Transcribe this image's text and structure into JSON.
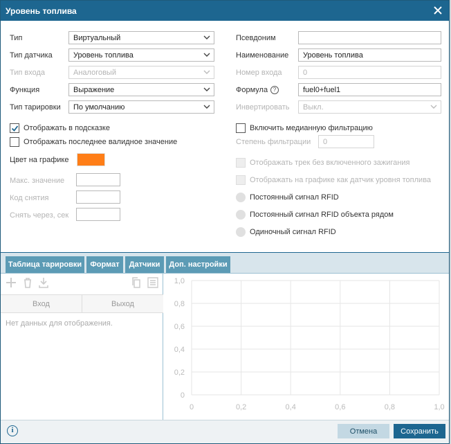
{
  "dialog": {
    "title": "Уровень топлива"
  },
  "left": {
    "type_label": "Тип",
    "type_value": "Виртуальный",
    "sensor_type_label": "Тип датчика",
    "sensor_type_value": "Уровень топлива",
    "input_type_label": "Тип входа",
    "input_type_value": "Аналоговый",
    "function_label": "Функция",
    "function_value": "Выражение",
    "calib_type_label": "Тип тарировки",
    "calib_type_value": "По умолчанию",
    "show_tooltip_label": "Отображать в подсказке",
    "show_last_valid_label": "Отображать последнее валидное значение",
    "chart_color_label": "Цвет на графике",
    "max_value_label": "Макс. значение",
    "removal_code_label": "Код снятия",
    "remove_after_label": "Снять через, сек"
  },
  "right": {
    "alias_label": "Псевдоним",
    "alias_value": "",
    "name_label": "Наименование",
    "name_value": "Уровень топлива",
    "input_number_label": "Номер входа",
    "input_number_value": "0",
    "formula_label": "Формула",
    "formula_value": "fuel0+fuel1",
    "invert_label": "Инвертировать",
    "invert_value": "Выкл.",
    "median_filter_label": "Включить медианную фильтрацию",
    "filter_degree_label": "Степень фильтрации",
    "filter_degree_value": "0",
    "track_no_ignition_label": "Отображать трек без включенного зажигания",
    "show_as_fuel_label": "Отображать на графике как датчик уровня топлива",
    "rfid_constant_label": "Постоянный сигнал RFID",
    "rfid_nearby_label": "Постоянный сигнал RFID объекта рядом",
    "rfid_single_label": "Одиночный сигнал RFID"
  },
  "tabs": [
    {
      "label": "Таблица тарировки"
    },
    {
      "label": "Формат"
    },
    {
      "label": "Датчики"
    },
    {
      "label": "Доп. настройки"
    }
  ],
  "table": {
    "col_in": "Вход",
    "col_out": "Выход",
    "empty": "Нет данных для отображения."
  },
  "chart_data": {
    "type": "line",
    "series": [],
    "xlim": [
      0,
      1
    ],
    "ylim": [
      0,
      1
    ],
    "x_ticks": [
      "0",
      "0,2",
      "0,4",
      "0,6",
      "0,8",
      "1,0"
    ],
    "y_ticks": [
      "0",
      "0,2",
      "0,4",
      "0,6",
      "0,8",
      "1,0"
    ],
    "grid": true
  },
  "footer": {
    "cancel": "Отмена",
    "save": "Сохранить"
  },
  "colors": {
    "accent": "#1d6690",
    "tab": "#5c9bb5",
    "chart_color": "#ff7e17"
  }
}
